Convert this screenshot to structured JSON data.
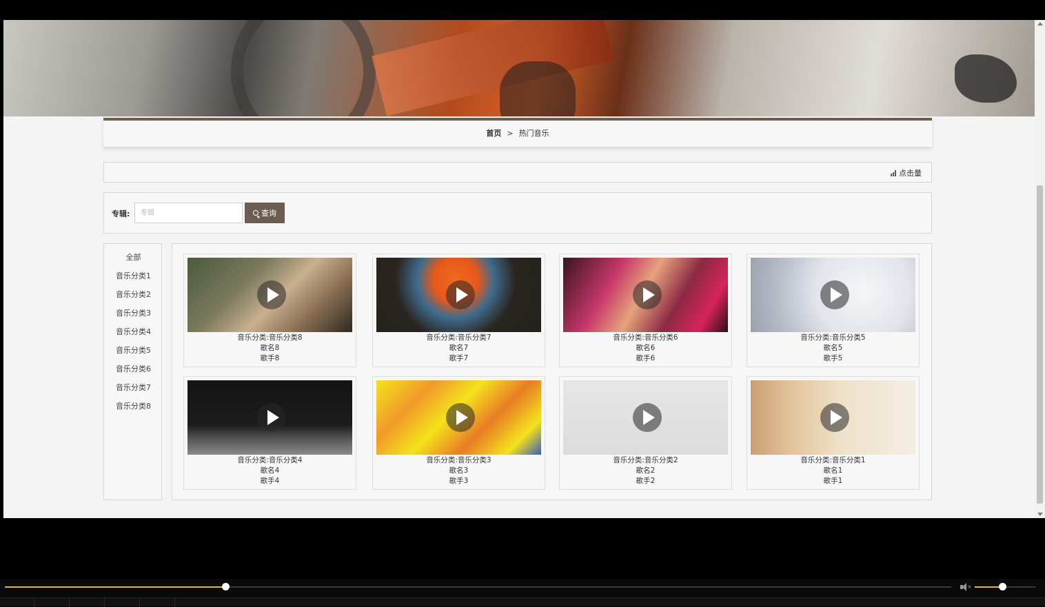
{
  "breadcrumb": {
    "home": "首页",
    "separator": ">",
    "current": "热门音乐"
  },
  "sort": {
    "label": "点击量",
    "icon": "bar-chart-icon"
  },
  "search": {
    "label": "专辑:",
    "placeholder": "专辑",
    "value": "",
    "button_label": "查询",
    "button_icon": "search-icon"
  },
  "categories": [
    "全部",
    "音乐分类1",
    "音乐分类2",
    "音乐分类3",
    "音乐分类4",
    "音乐分类5",
    "音乐分类6",
    "音乐分类7",
    "音乐分类8"
  ],
  "music_items": [
    {
      "category": "音乐分类:音乐分类8",
      "name": "歌名8",
      "singer": "歌手8"
    },
    {
      "category": "音乐分类:音乐分类7",
      "name": "歌名7",
      "singer": "歌手7"
    },
    {
      "category": "音乐分类:音乐分类6",
      "name": "歌名6",
      "singer": "歌手6"
    },
    {
      "category": "音乐分类:音乐分类5",
      "name": "歌名5",
      "singer": "歌手5"
    },
    {
      "category": "音乐分类:音乐分类4",
      "name": "歌名4",
      "singer": "歌手4"
    },
    {
      "category": "音乐分类:音乐分类3",
      "name": "歌名3",
      "singer": "歌手3"
    },
    {
      "category": "音乐分类:音乐分类2",
      "name": "歌名2",
      "singer": "歌手2"
    },
    {
      "category": "音乐分类:音乐分类1",
      "name": "歌名1",
      "singer": "歌手1"
    }
  ],
  "player": {
    "progress": 0.233,
    "volume": 0.45,
    "volume_icon": "muted-speaker-icon"
  },
  "colors": {
    "accent": "#6b5d4f",
    "progress": "#e5c100"
  }
}
